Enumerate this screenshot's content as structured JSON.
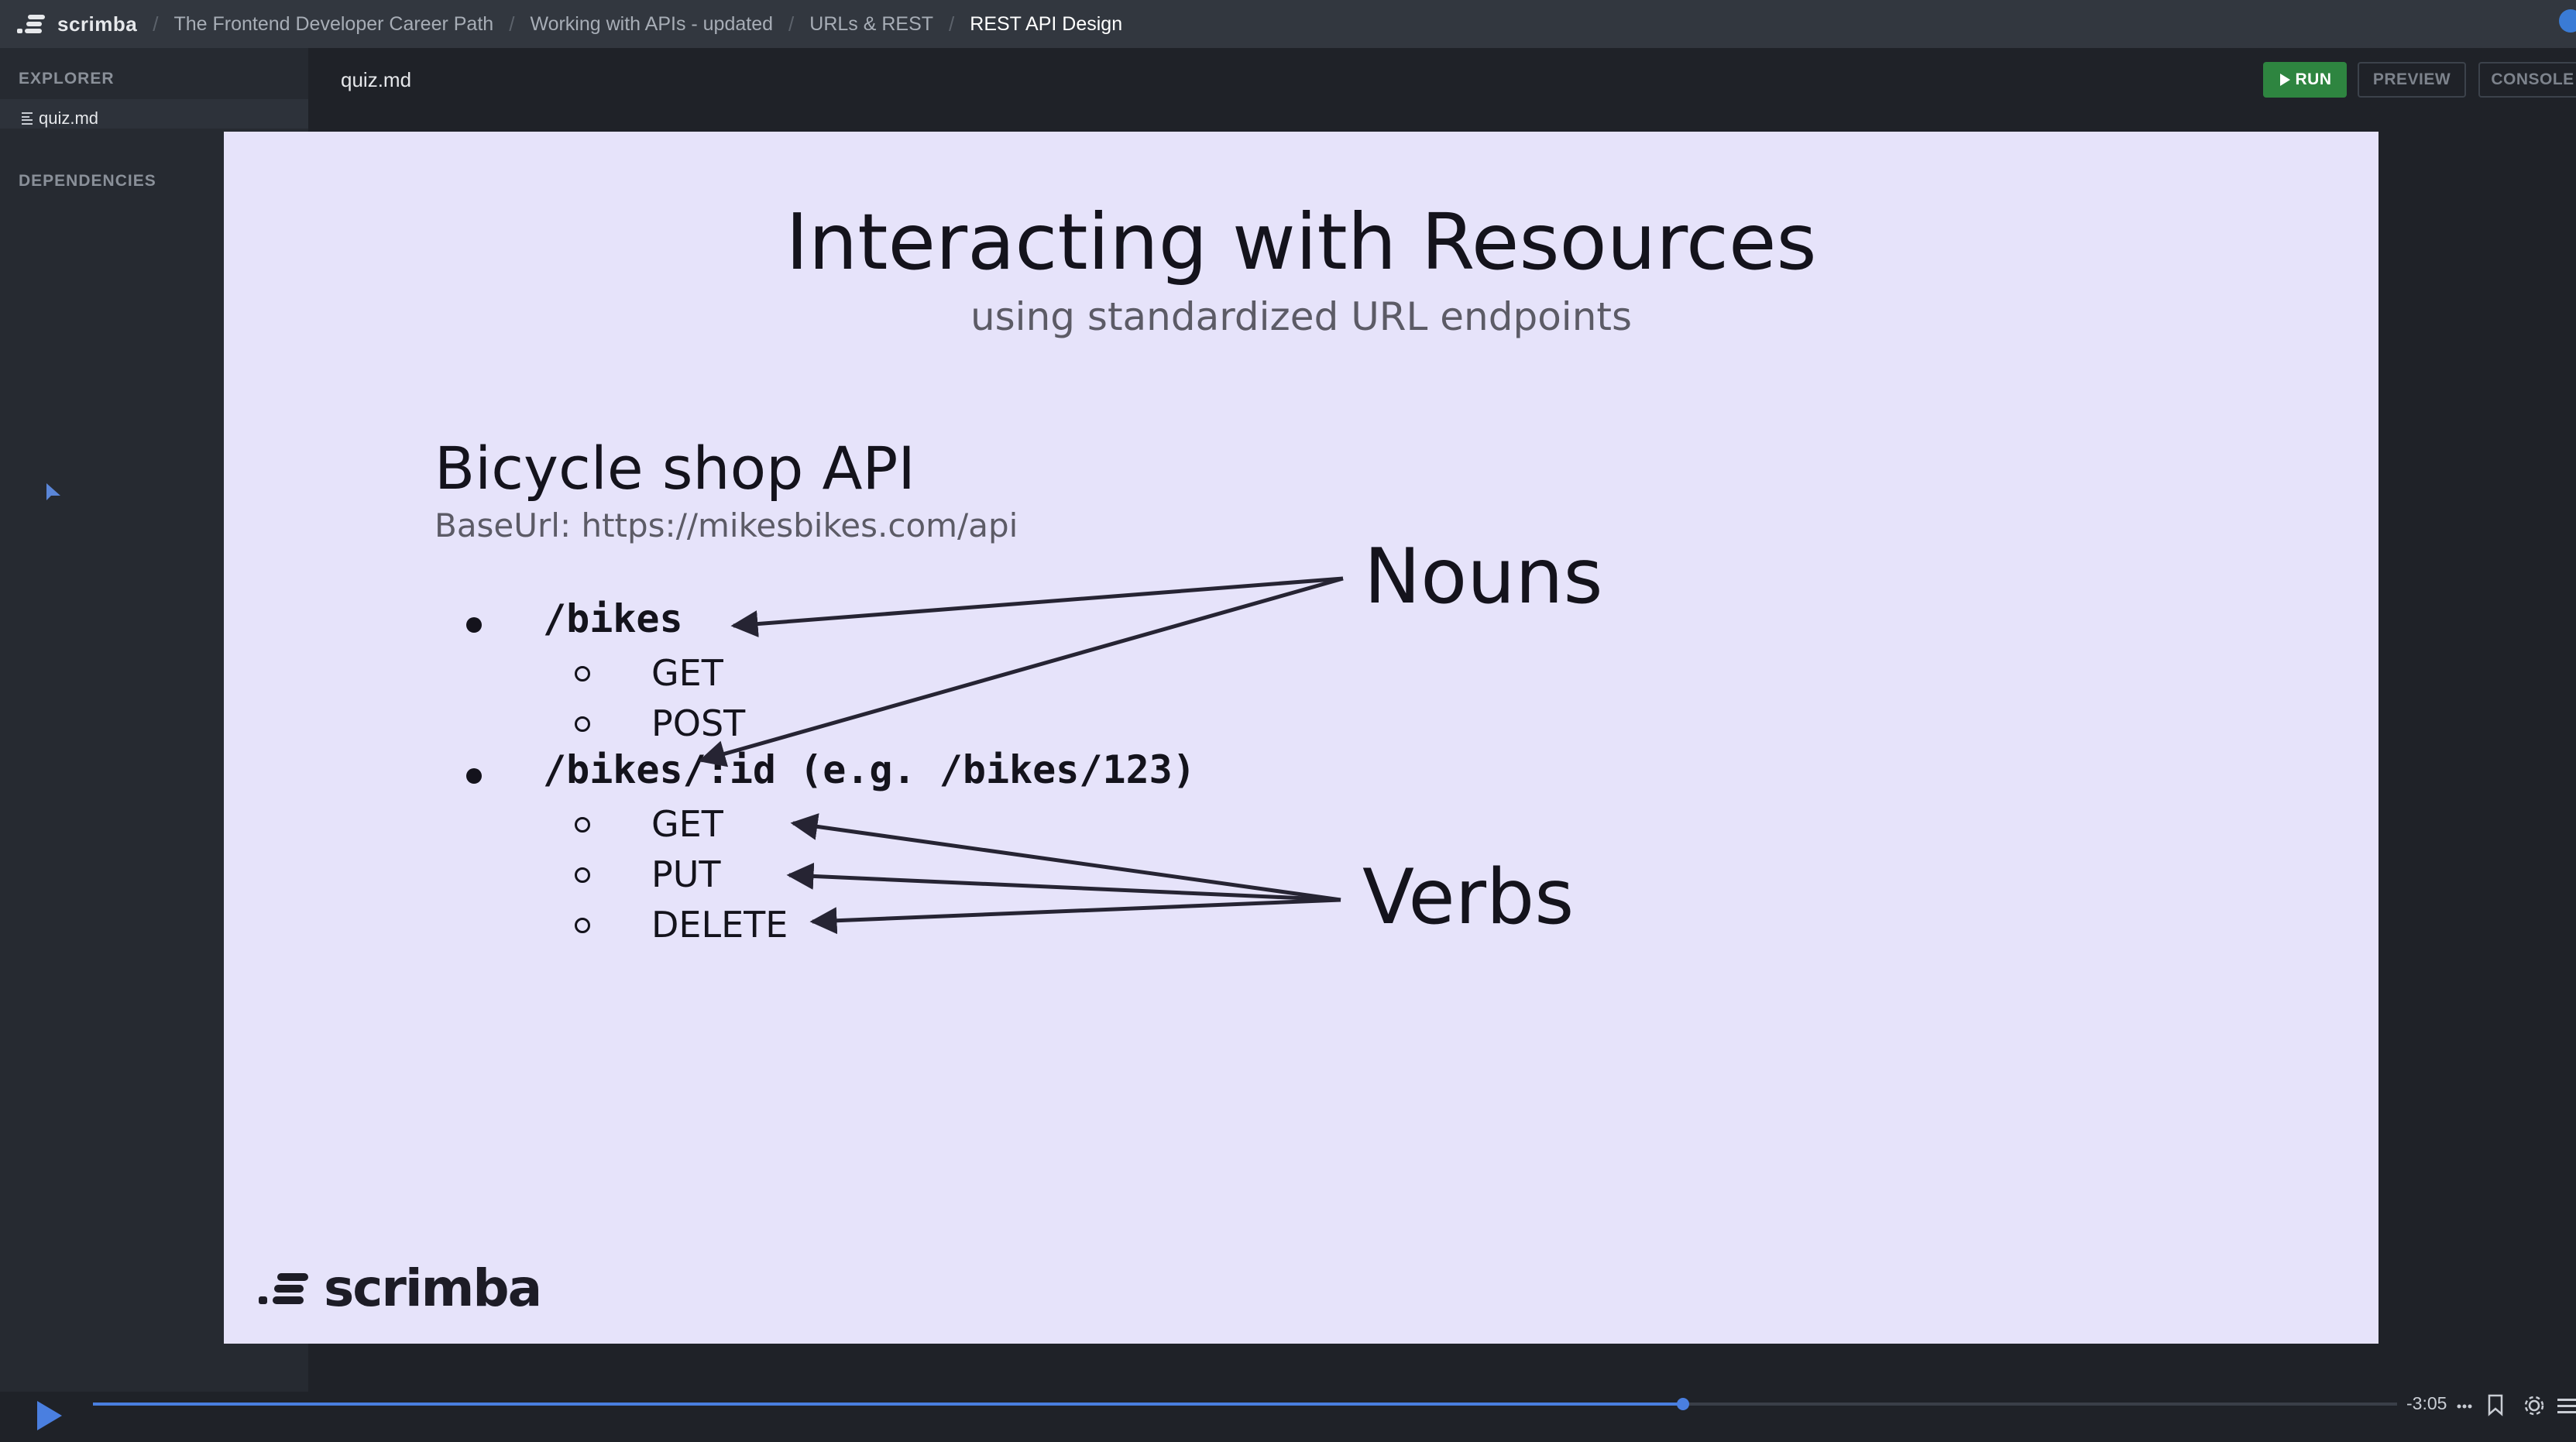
{
  "header": {
    "logo_text": "scrimba",
    "breadcrumbs": [
      "The Frontend Developer Career Path",
      "Working with APIs - updated",
      "URLs & REST",
      "REST API Design"
    ]
  },
  "sidebar": {
    "explorer_label": "EXPLORER",
    "file_name": "quiz.md",
    "dependencies_label": "DEPENDENCIES"
  },
  "editor": {
    "tab_name": "quiz.md",
    "run_label": "RUN",
    "preview_label": "PREVIEW",
    "console_label": "CONSOLE"
  },
  "slide": {
    "title": "Interacting with Resources",
    "subtitle": "using standardized URL endpoints",
    "api_title": "Bicycle shop API",
    "base_url": "BaseUrl: https://mikesbikes.com/api",
    "endpoints": [
      {
        "path": "/bikes",
        "methods": [
          "GET",
          "POST"
        ]
      },
      {
        "path": "/bikes/:id (e.g. /bikes/123)",
        "methods": [
          "GET",
          "PUT",
          "DELETE"
        ]
      }
    ],
    "nouns_label": "Nouns",
    "verbs_label": "Verbs",
    "logo_text": "scrimba",
    "background_color": "#e6e3fa"
  },
  "player": {
    "progress": 0.69,
    "time_remaining": "-3:05"
  },
  "colors": {
    "accent": "#4a7fe0",
    "run_green": "#2e8540"
  }
}
